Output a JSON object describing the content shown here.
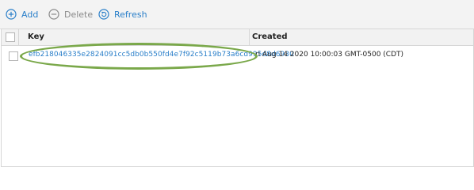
{
  "toolbar": {
    "add_label": "Add",
    "delete_label": "Delete",
    "refresh_label": "Refresh",
    "accent": "#2a7fc9",
    "disabled": "#8a8a8a"
  },
  "grid": {
    "columns": [
      "Key",
      "Created"
    ],
    "rows": [
      {
        "key": "efb218046335e2824091cc5db0b550fd4e7f92c5119b73a6cd995d8d6930",
        "created": "ri Aug 14 2020 10:00:03 GMT-0500 (CDT)"
      }
    ]
  },
  "annotation": {
    "color": "#7aa84a",
    "shape": "ellipse"
  }
}
